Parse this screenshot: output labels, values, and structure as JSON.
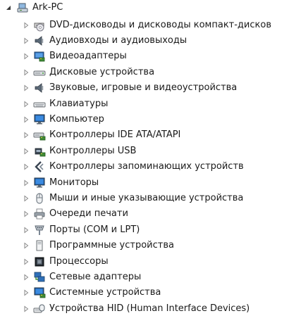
{
  "root": {
    "label": "Ark-PC",
    "expanded": true,
    "icon": "computer-icon"
  },
  "items": [
    {
      "label": "DVD-дисководы и дисководы компакт-дисков",
      "icon": "dvd-drive-icon"
    },
    {
      "label": "Аудиовходы и аудиовыходы",
      "icon": "speaker-icon"
    },
    {
      "label": "Видеоадаптеры",
      "icon": "display-adapter-icon"
    },
    {
      "label": "Дисковые устройства",
      "icon": "disk-drive-icon"
    },
    {
      "label": "Звуковые, игровые и видеоустройства",
      "icon": "speaker-icon"
    },
    {
      "label": "Клавиатуры",
      "icon": "keyboard-icon"
    },
    {
      "label": "Компьютер",
      "icon": "monitor-icon"
    },
    {
      "label": "Контроллеры IDE ATA/ATAPI",
      "icon": "ide-controller-icon"
    },
    {
      "label": "Контроллеры USB",
      "icon": "usb-controller-icon"
    },
    {
      "label": "Контроллеры запоминающих устройств",
      "icon": "storage-controller-icon"
    },
    {
      "label": "Мониторы",
      "icon": "monitor-icon"
    },
    {
      "label": "Мыши и иные указывающие устройства",
      "icon": "mouse-icon"
    },
    {
      "label": "Очереди печати",
      "icon": "printer-icon"
    },
    {
      "label": "Порты (COM и LPT)",
      "icon": "port-icon"
    },
    {
      "label": "Программные устройства",
      "icon": "software-device-icon"
    },
    {
      "label": "Процессоры",
      "icon": "processor-icon"
    },
    {
      "label": "Сетевые адаптеры",
      "icon": "network-adapter-icon"
    },
    {
      "label": "Системные устройства",
      "icon": "system-device-icon"
    },
    {
      "label": "Устройства HID (Human Interface Devices)",
      "icon": "hid-icon"
    }
  ]
}
